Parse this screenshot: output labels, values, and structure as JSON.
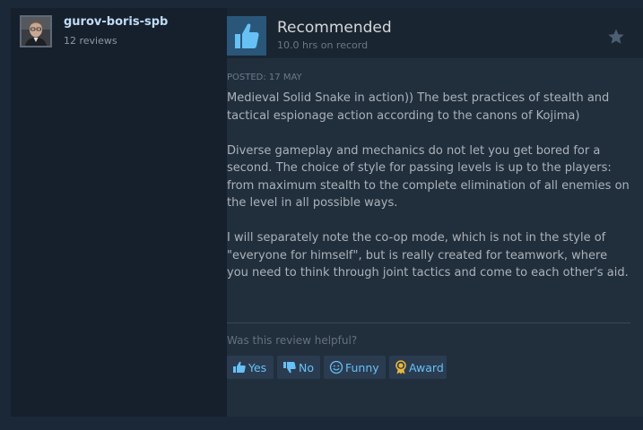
{
  "author": {
    "name": "gurov-boris-spb",
    "reviews_count": "12 reviews"
  },
  "review": {
    "verdict": "Recommended",
    "hours": "10.0 hrs on record",
    "posted": "POSTED: 17 MAY",
    "paragraphs": [
      "Medieval Solid Snake in action)) The best practices of stealth and tactical espionage action according to the canons of Kojima)",
      "Diverse gameplay and mechanics do not let you get bored for a second. The choice of style for passing levels is up to the players: from maximum stealth to the complete elimination of all enemies on the level in all possible ways.",
      "I will separately note the co-op mode, which is not in the style of \"everyone for himself\", but is really created for teamwork, where you need to think through joint tactics and come to each other's aid."
    ]
  },
  "helpful": {
    "question": "Was this review helpful?",
    "yes_label": "Yes",
    "no_label": "No",
    "funny_label": "Funny",
    "award_label": "Award"
  },
  "icons": {
    "thumb": "thumbs-up-icon",
    "star": "star-icon",
    "yes": "thumbs-up-icon",
    "no": "thumbs-down-icon",
    "funny": "smiley-icon",
    "award": "award-ribbon-icon"
  },
  "colors": {
    "page_bg": "#1b2838",
    "panel_bg": "#16202d",
    "review_bg": "#212f3d",
    "thumb_bg": "#2a5679",
    "link_blue": "#67c1f5",
    "author_name": "#c1dbf4",
    "award_gold": "#e8b83a"
  }
}
